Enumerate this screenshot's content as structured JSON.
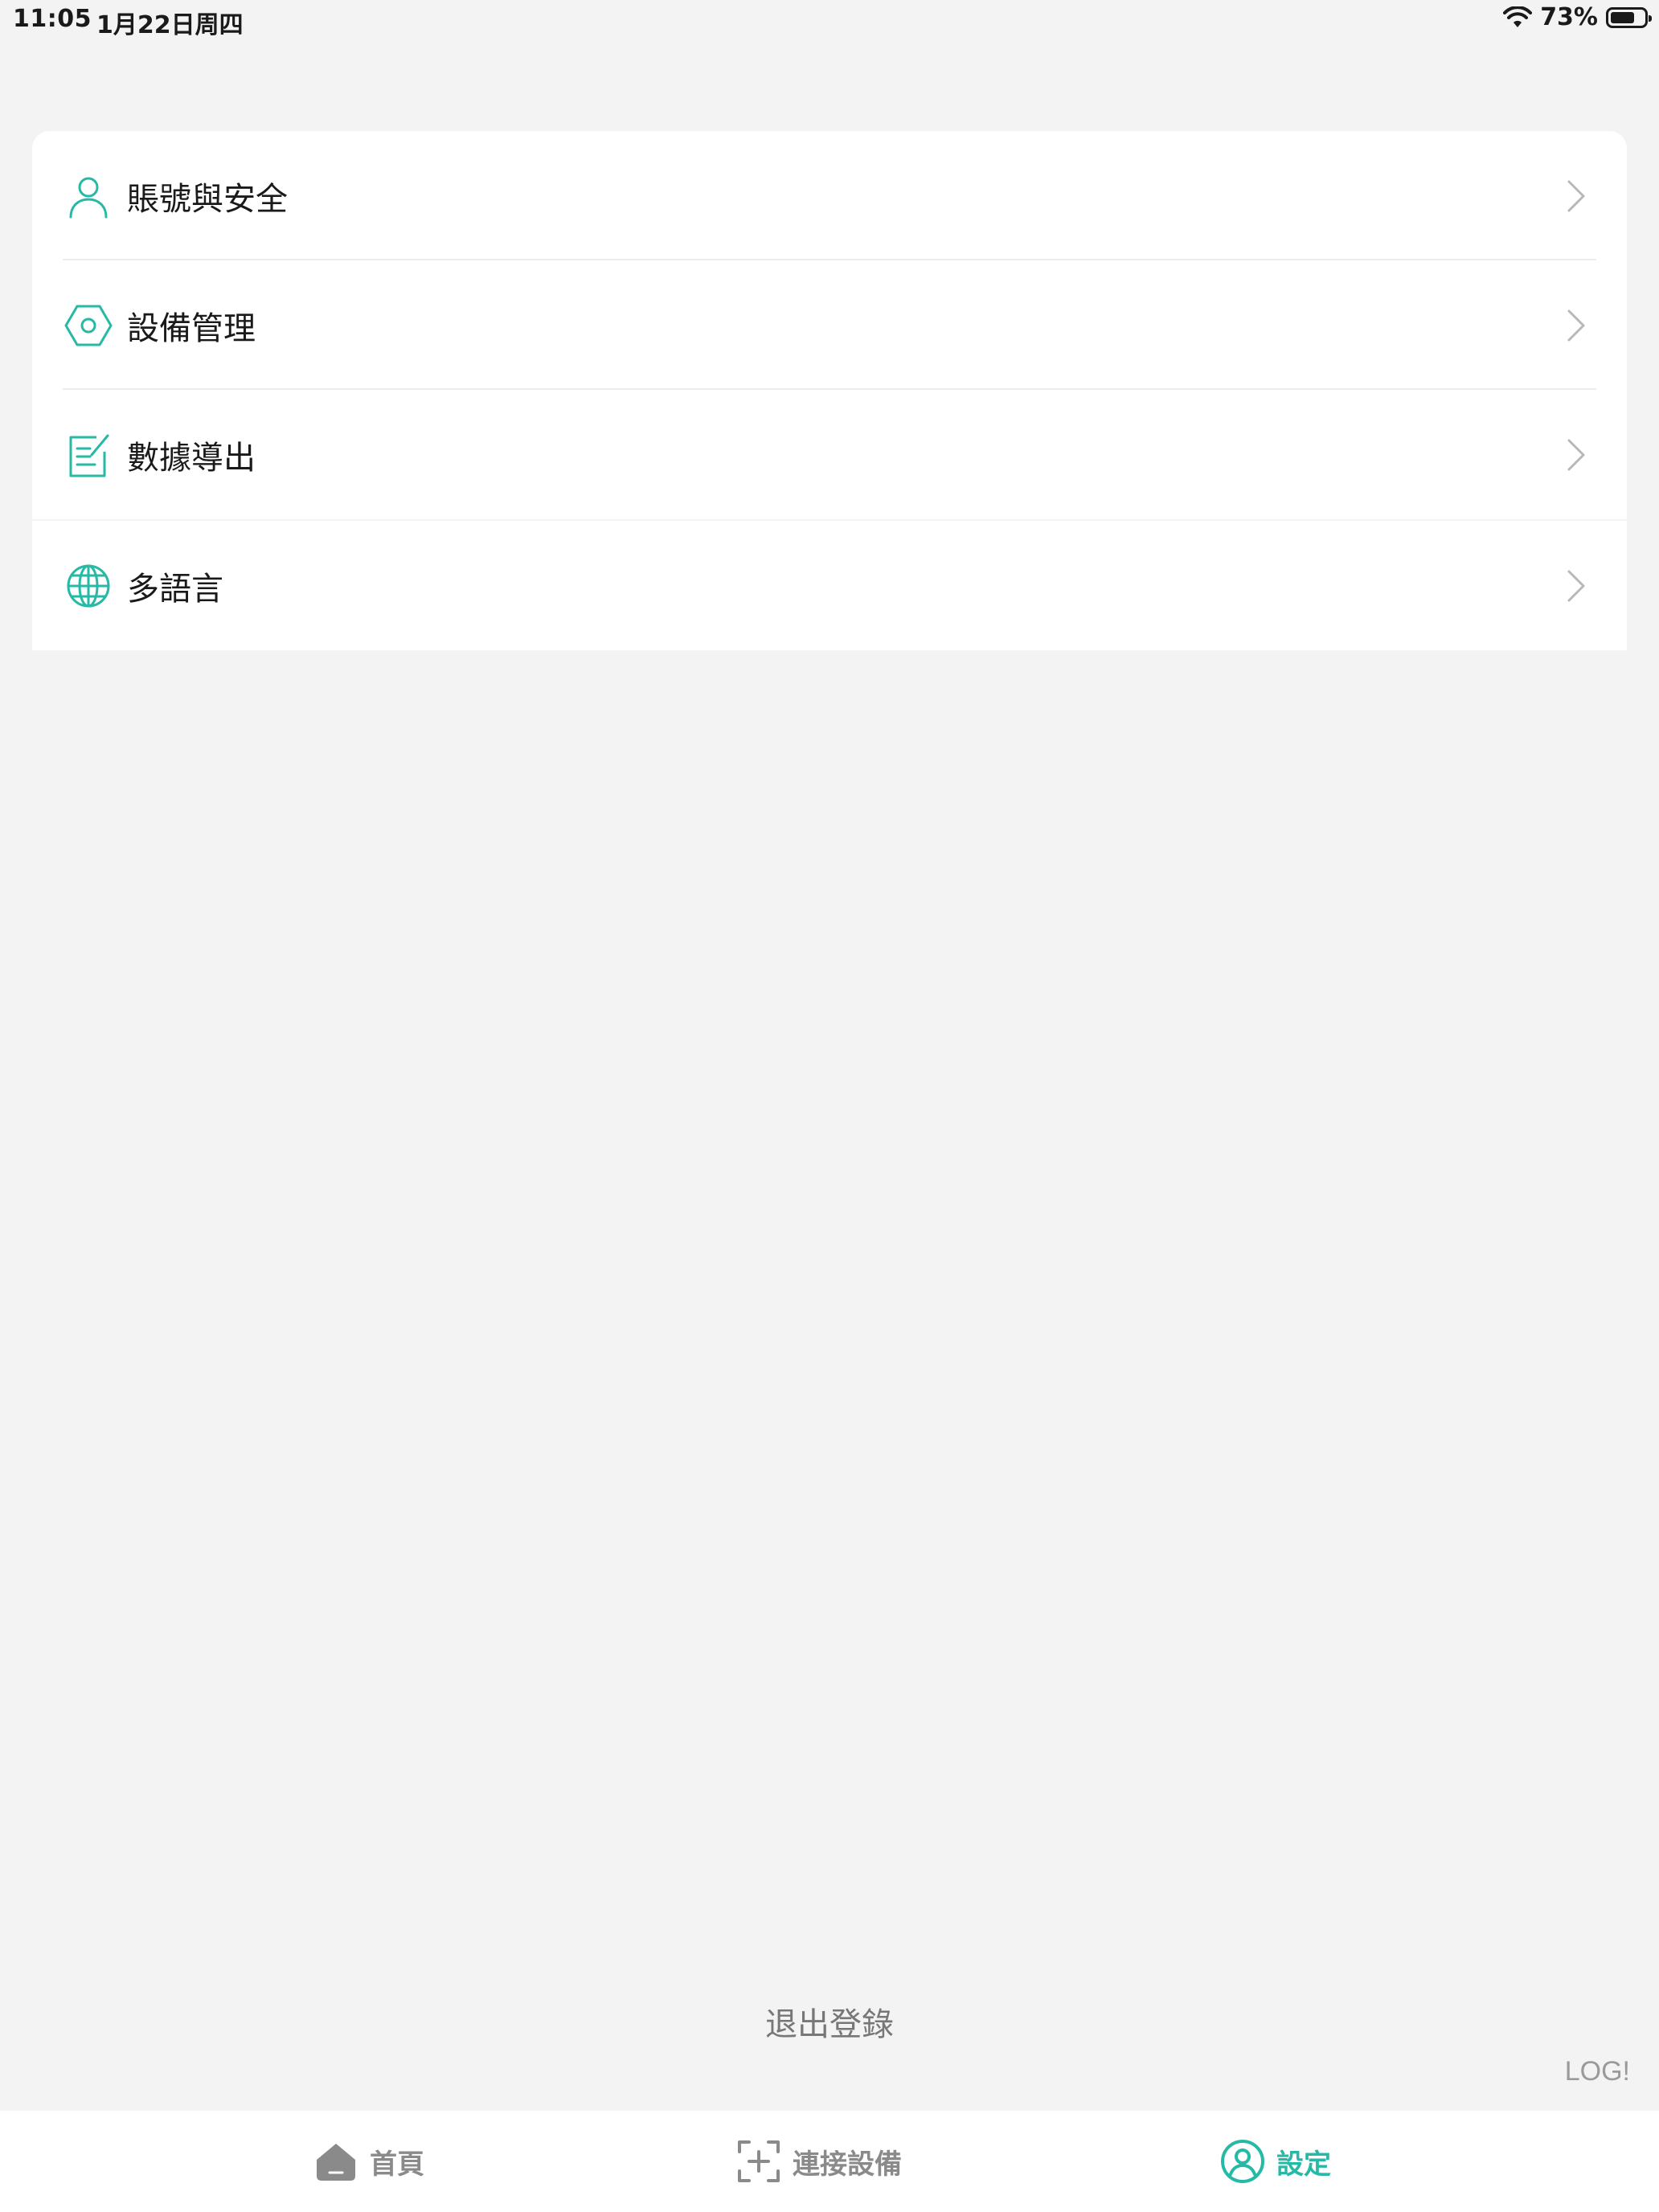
{
  "status_bar": {
    "time": "11:05",
    "date": "1月22日周四",
    "battery_percent": "73%",
    "battery_level": 0.73
  },
  "menu": {
    "items": [
      {
        "label": "賬號與安全",
        "icon": "user-icon"
      },
      {
        "label": "設備管理",
        "icon": "hexagon-device-icon"
      },
      {
        "label": "數據導出",
        "icon": "export-edit-icon"
      },
      {
        "label": "多語言",
        "icon": "globe-icon"
      }
    ]
  },
  "logout_label": "退出登錄",
  "log_label": "LOG!",
  "tab_bar": {
    "tabs": [
      {
        "label": "首頁",
        "icon": "home-icon",
        "active": false
      },
      {
        "label": "連接設備",
        "icon": "scan-add-icon",
        "active": false
      },
      {
        "label": "設定",
        "icon": "profile-icon",
        "active": true
      }
    ]
  },
  "colors": {
    "accent": "#25b9a6",
    "background": "#f3f3f3",
    "card": "#ffffff",
    "inactive_tab": "#8a8a8a"
  }
}
